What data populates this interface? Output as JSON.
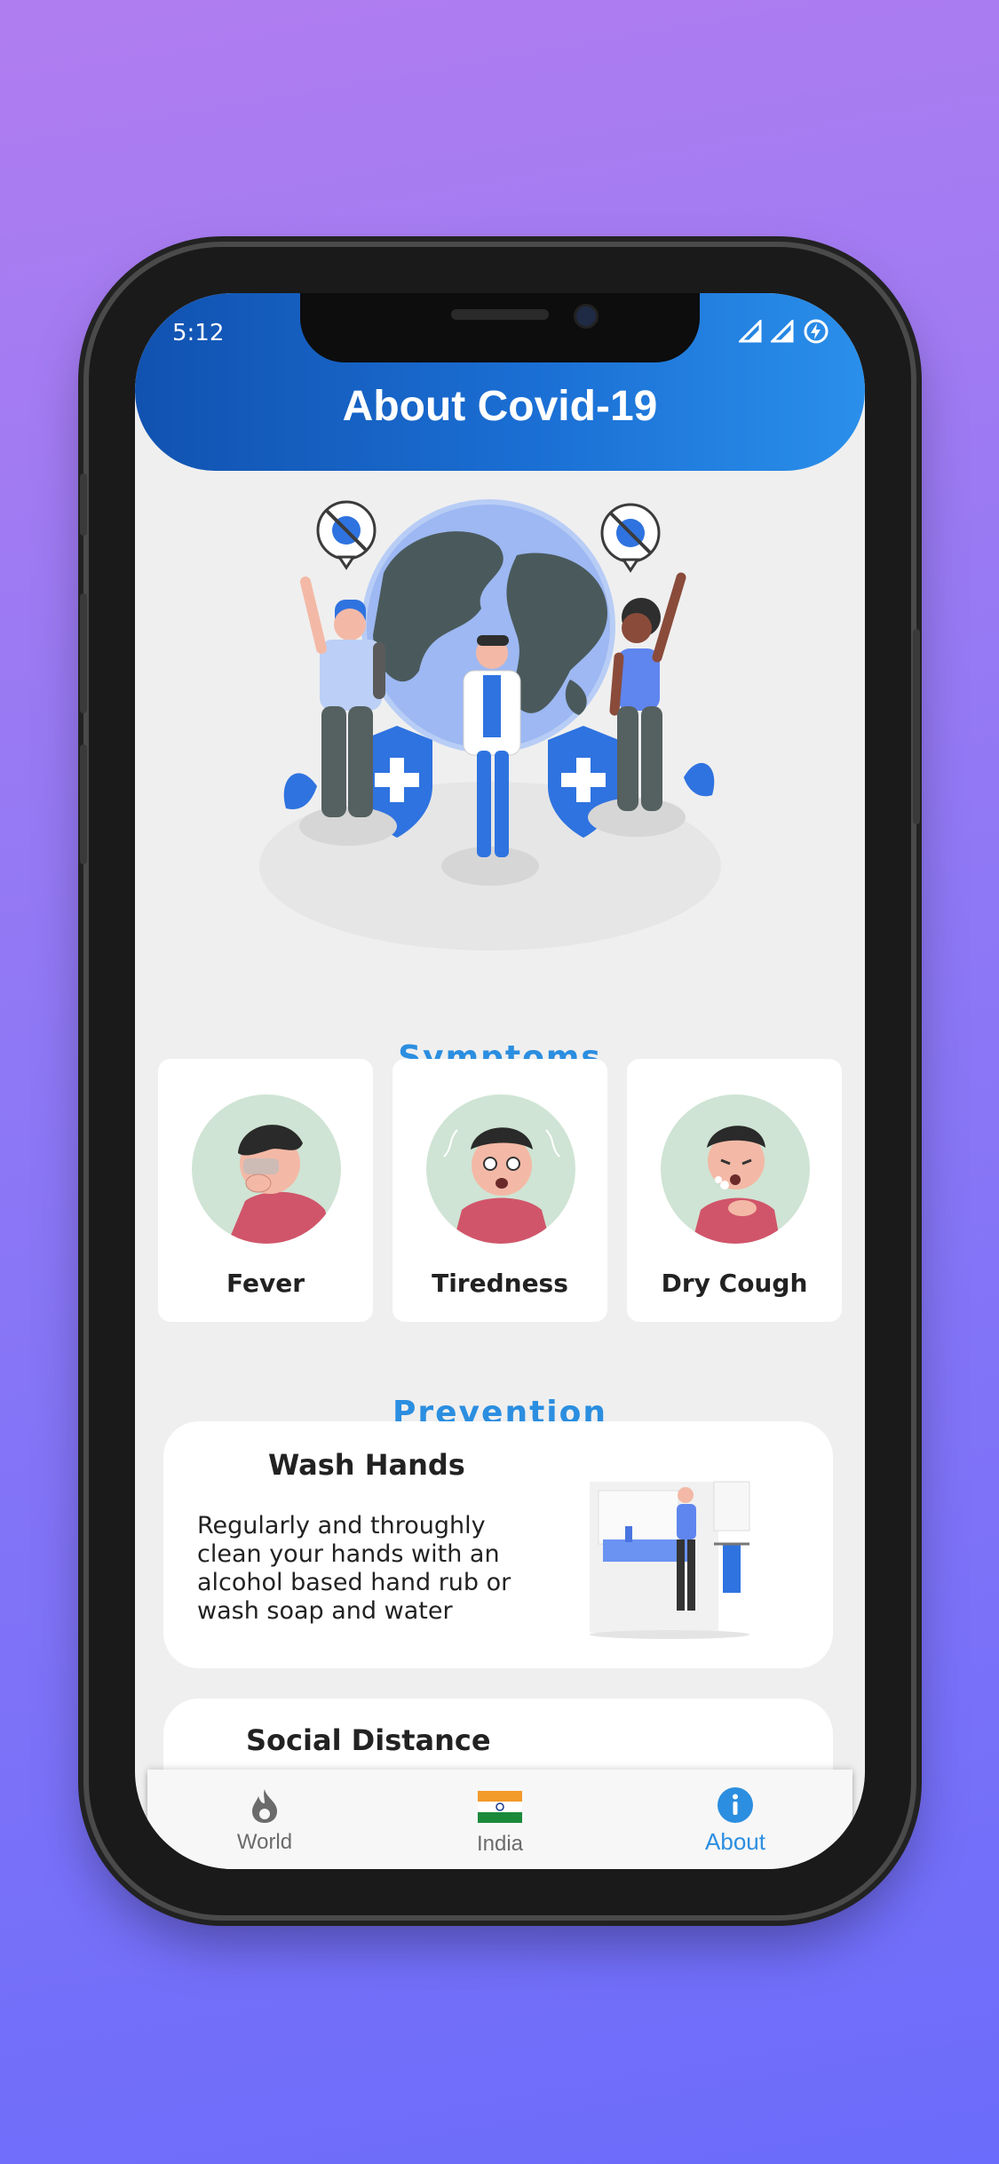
{
  "status_bar": {
    "time": "5:12"
  },
  "header": {
    "title": "About Covid-19"
  },
  "symptoms": {
    "title": "Symptoms",
    "items": [
      {
        "label": "Fever"
      },
      {
        "label": "Tiredness"
      },
      {
        "label": "Dry Cough"
      }
    ]
  },
  "prevention": {
    "title": "Prevention",
    "items": [
      {
        "title": "Wash Hands",
        "text": "Regularly and throughly clean your hands with an alcohol based hand rub or wash soap and water"
      },
      {
        "title": "Social Distance"
      }
    ]
  },
  "tabs": [
    {
      "label": "World",
      "icon": "flame-icon",
      "active": false
    },
    {
      "label": "India",
      "icon": "india-flag-icon",
      "active": false
    },
    {
      "label": "About",
      "icon": "info-icon",
      "active": true
    }
  ],
  "colors": {
    "accent": "#2b8ee0",
    "header_start": "#1152b0",
    "header_end": "#2a8fea",
    "inactive_tab": "#6b6b6b"
  }
}
